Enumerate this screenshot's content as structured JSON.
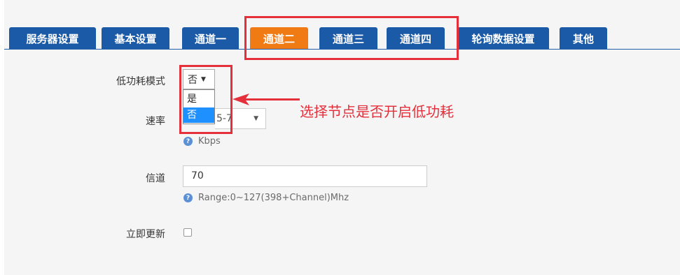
{
  "tabs": [
    {
      "label": "服务器设置",
      "active": false
    },
    {
      "label": "基本设置",
      "active": false
    },
    {
      "label": "通道一",
      "active": false
    },
    {
      "label": "通道二",
      "active": true
    },
    {
      "label": "通道三",
      "active": false
    },
    {
      "label": "通道四",
      "active": false
    },
    {
      "label": "轮询数据设置",
      "active": false
    },
    {
      "label": "其他",
      "active": false
    }
  ],
  "form": {
    "low_power": {
      "label": "低功耗模式",
      "selected": "否",
      "options": [
        "是",
        "否"
      ],
      "highlighted_option": "否"
    },
    "rate": {
      "label": "速率",
      "value_fragment": "5-7",
      "help": "Kbps"
    },
    "channel": {
      "label": "信道",
      "value": "70",
      "help": "Range:0~127(398+Channel)Mhz"
    },
    "update_now": {
      "label": "立即更新",
      "checked": false
    }
  },
  "annotation": {
    "text": "选择节点是否开启低功耗"
  },
  "colors": {
    "tab_blue": "#1b5aa6",
    "tab_active_orange": "#f07a14",
    "highlight_red": "#e5303b",
    "dropdown_selected": "#1e90ff"
  },
  "icons": {
    "help": "question-circle-icon",
    "caret": "caret-down-icon"
  }
}
